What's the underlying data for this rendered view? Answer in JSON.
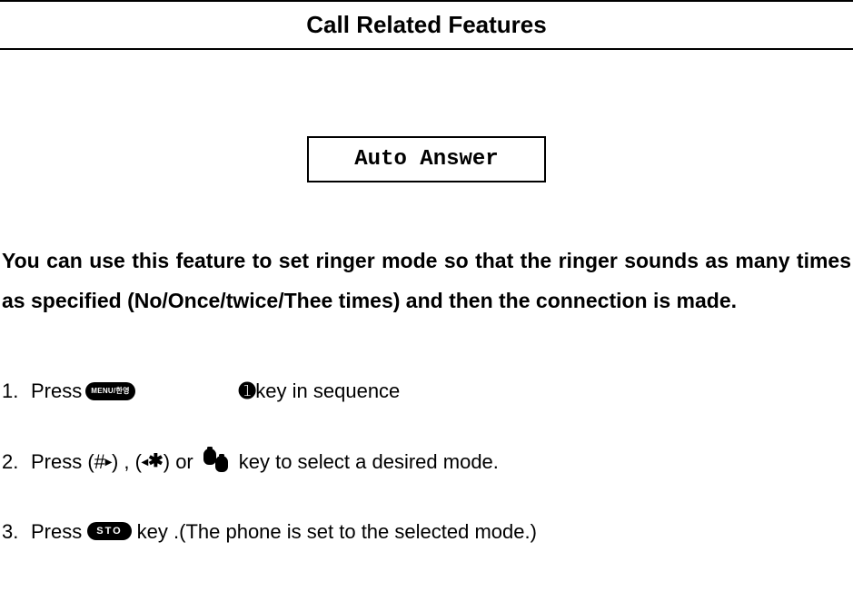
{
  "header": {
    "title": "Call Related Features"
  },
  "box": {
    "label": "Auto Answer"
  },
  "description": "You can use this feature to set ringer mode so that the ringer sounds as many times as specified (No/Once/twice/Thee times) and then the connection is made.",
  "steps": [
    {
      "num": "1.",
      "parts": {
        "a": "Press",
        "menu_key_label": "MENU/한영",
        "circled_one": "➊",
        "b": " key in sequence"
      }
    },
    {
      "num": "2.",
      "parts": {
        "a": "Press (# ",
        "arrow_r": "▸",
        "b": ") , (",
        "arrow_l": "◂",
        "star": " ✱",
        "c": ") or ",
        "d": " key to select a desired mode."
      }
    },
    {
      "num": "3.",
      "parts": {
        "a": "Press",
        "sto_key_label": "STO",
        "b": " key .(The phone is set to the selected mode.)"
      }
    }
  ]
}
